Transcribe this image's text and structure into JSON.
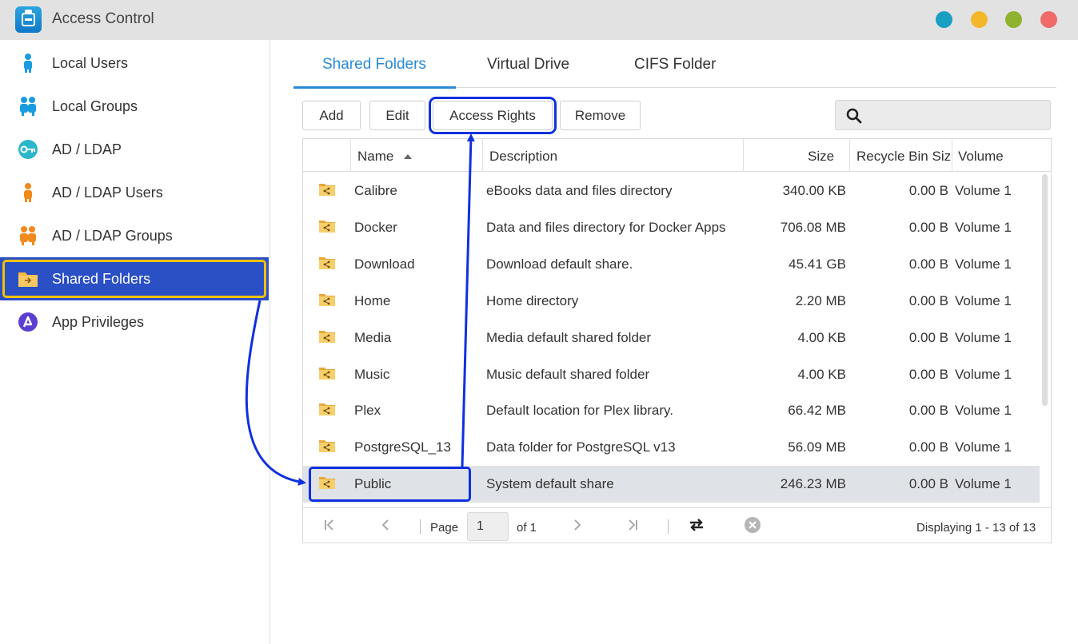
{
  "window": {
    "title": "Access Control",
    "app_icon": "access-control-icon",
    "controls": [
      {
        "name": "minimize-dot",
        "color": "#1a9fc3"
      },
      {
        "name": "zoom-dot",
        "color": "#f4b72a"
      },
      {
        "name": "maximize-dot",
        "color": "#8fb22f"
      },
      {
        "name": "close-dot",
        "color": "#f06a6a"
      }
    ]
  },
  "sidebar": {
    "items": [
      {
        "label": "Local Users",
        "icon": "user-icon",
        "active": false
      },
      {
        "label": "Local Groups",
        "icon": "group-icon",
        "active": false
      },
      {
        "label": "AD / LDAP",
        "icon": "key-icon",
        "active": false
      },
      {
        "label": "AD / LDAP Users",
        "icon": "ldap-user-icon",
        "active": false
      },
      {
        "label": "AD / LDAP Groups",
        "icon": "ldap-group-icon",
        "active": false
      },
      {
        "label": "Shared Folders",
        "icon": "shared-folder-icon",
        "active": true
      },
      {
        "label": "App Privileges",
        "icon": "app-privileges-icon",
        "active": false
      }
    ]
  },
  "tabs": [
    {
      "label": "Shared Folders",
      "active": true
    },
    {
      "label": "Virtual Drive",
      "active": false
    },
    {
      "label": "CIFS Folder",
      "active": false
    }
  ],
  "toolbar": {
    "add": "Add",
    "edit": "Edit",
    "access_rights": "Access Rights",
    "remove": "Remove",
    "search_placeholder": ""
  },
  "grid": {
    "columns": [
      "Name",
      "Description",
      "Size",
      "Recycle Bin Size",
      "Volume"
    ],
    "rows": [
      {
        "name": "Calibre",
        "description": "eBooks data and files directory",
        "size": "340.00 KB",
        "recycle": "0.00 B",
        "volume": "Volume 1"
      },
      {
        "name": "Docker",
        "description": "Data and files directory for Docker Apps",
        "size": "706.08 MB",
        "recycle": "0.00 B",
        "volume": "Volume 1"
      },
      {
        "name": "Download",
        "description": "Download default share.",
        "size": "45.41 GB",
        "recycle": "0.00 B",
        "volume": "Volume 1"
      },
      {
        "name": "Home",
        "description": "Home directory",
        "size": "2.20 MB",
        "recycle": "0.00 B",
        "volume": "Volume 1"
      },
      {
        "name": "Media",
        "description": "Media default shared folder",
        "size": "4.00 KB",
        "recycle": "0.00 B",
        "volume": "Volume 1"
      },
      {
        "name": "Music",
        "description": "Music default shared folder",
        "size": "4.00 KB",
        "recycle": "0.00 B",
        "volume": "Volume 1"
      },
      {
        "name": "Plex",
        "description": "Default location for Plex library.",
        "size": "66.42 MB",
        "recycle": "0.00 B",
        "volume": "Volume 1"
      },
      {
        "name": "PostgreSQL_13",
        "description": "Data folder for PostgreSQL v13",
        "size": "56.09 MB",
        "recycle": "0.00 B",
        "volume": "Volume 1"
      },
      {
        "name": "Public",
        "description": "System default share",
        "size": "246.23 MB",
        "recycle": "0.00 B",
        "volume": "Volume 1",
        "selected": true
      }
    ]
  },
  "pager": {
    "page_label": "Page",
    "page_value": "1",
    "of_label": "of 1",
    "displaying": "Displaying 1 - 13 of 13"
  },
  "colors": {
    "accent": "#2a8ad6",
    "sidebar_active": "#2b4fc4",
    "highlight_yellow": "#f2c200",
    "annotation_blue": "#1030e0"
  }
}
